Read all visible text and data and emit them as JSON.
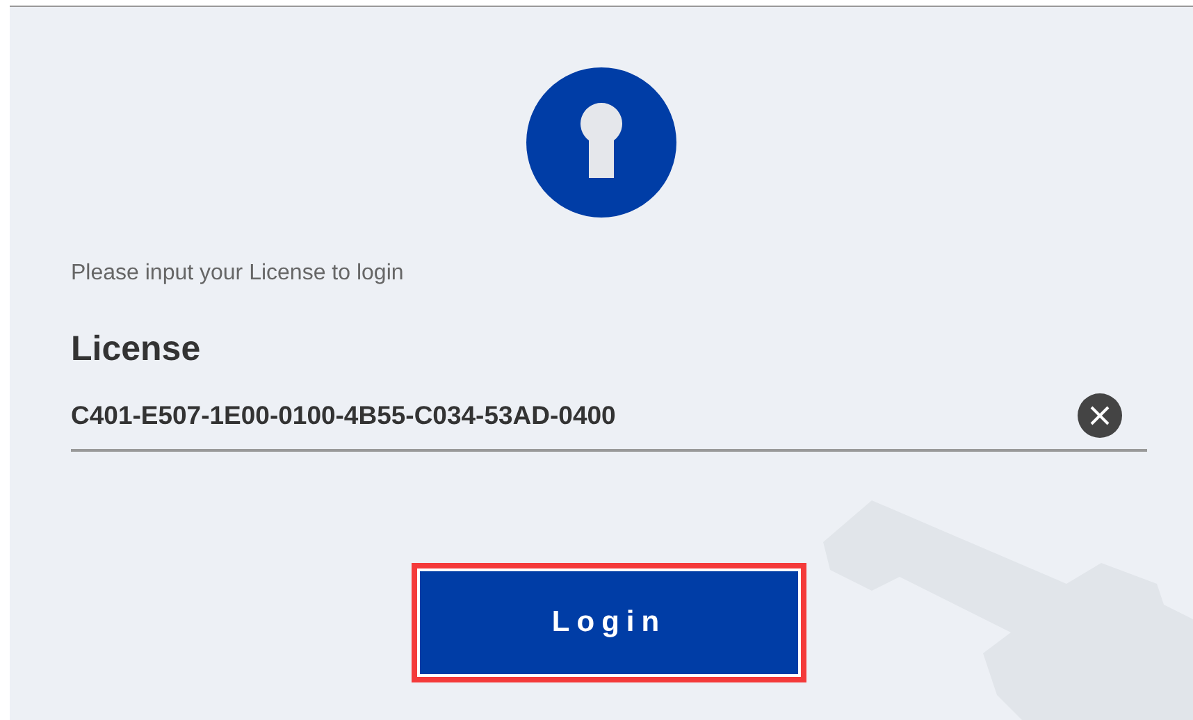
{
  "prompt": "Please input your License to login",
  "license": {
    "label": "License",
    "value": "C401-E507-1E00-0100-4B55-C034-53AD-0400"
  },
  "login_button": {
    "label": "Login",
    "highlighted": true
  }
}
